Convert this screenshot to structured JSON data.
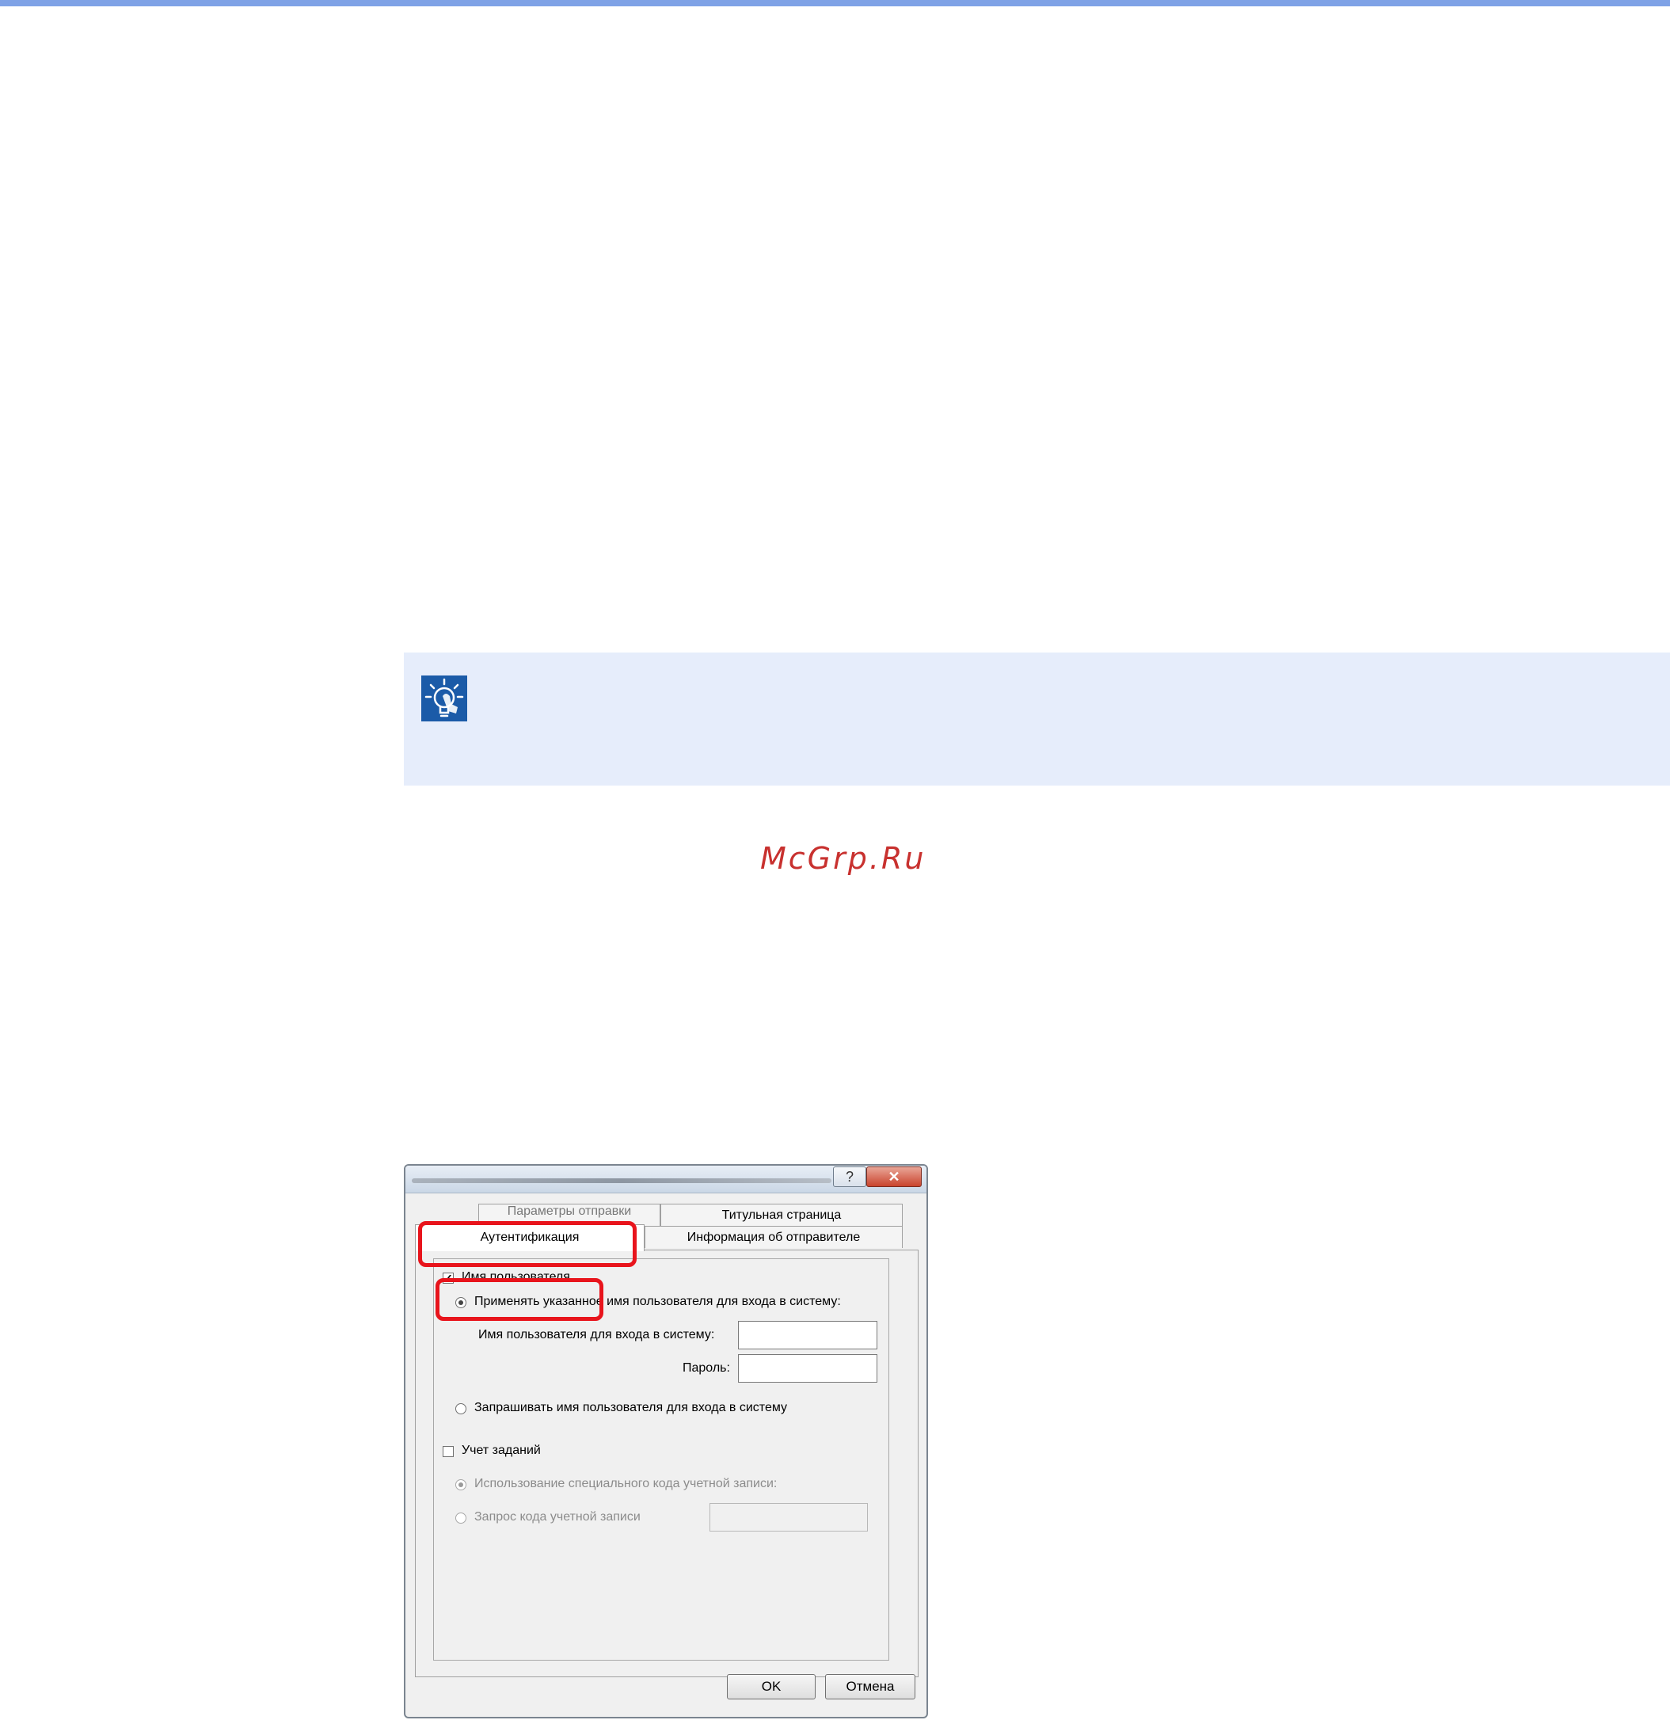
{
  "watermark": "McGrp.Ru",
  "note": {
    "icon": "lightbulb-hint-icon"
  },
  "dialog": {
    "close_glyph": "✕",
    "help_glyph": "?",
    "tabs": {
      "back_left": "Параметры отправки",
      "back_right": "Титульная страница",
      "front_left": "Аутентификация",
      "front_right": "Информация об отправителе"
    },
    "user_name": {
      "checkbox_label": "Имя пользователя",
      "checked": true,
      "option_specified": "Применять указанное имя пользователя для входа в систему:",
      "login_label": "Имя пользователя для входа в систему:",
      "login_value": "",
      "password_label": "Пароль:",
      "password_value": "",
      "option_prompt": "Запрашивать имя пользователя для входа в систему"
    },
    "job_accounting": {
      "checkbox_label": "Учет заданий",
      "checked": false,
      "option_specific": "Использование специального кода учетной записи:",
      "option_prompt": "Запрос кода учетной записи",
      "account_value": ""
    },
    "buttons": {
      "ok": "OK",
      "cancel": "Отмена"
    }
  },
  "colors": {
    "accent": "#7fa2e6",
    "note_bg": "#e6edfb",
    "icon_bg": "#1b5ba8",
    "highlight": "#e8141c",
    "watermark": "#c8312f"
  }
}
